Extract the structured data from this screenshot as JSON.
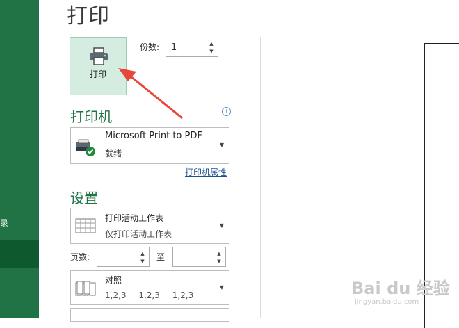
{
  "window": {
    "title": "打印"
  },
  "sidebar": {
    "partial_item": "录"
  },
  "print_button": {
    "label": "打印",
    "icon": "printer-icon"
  },
  "copies": {
    "label": "份数:",
    "value": "1"
  },
  "printer": {
    "section_title": "打印机",
    "name": "Microsoft Print to PDF",
    "status": "就绪",
    "properties_link": "打印机属性",
    "icon": "printer-ready-icon"
  },
  "settings": {
    "section_title": "设置",
    "scope": {
      "title": "打印活动工作表",
      "subtitle": "仅打印活动工作表"
    },
    "pages": {
      "label": "页数:",
      "to_label": "至",
      "from_value": "",
      "to_value": ""
    },
    "collate": {
      "title": "对照",
      "subtitle": "1,2,3    1,2,3    1,2,3"
    }
  },
  "watermark": {
    "line1": "Bai du 经验",
    "line2": "jingyan.baidu.com"
  },
  "colors": {
    "accent": "#217346",
    "button_bg": "#d4ede0",
    "arrow": "#e8463c"
  }
}
